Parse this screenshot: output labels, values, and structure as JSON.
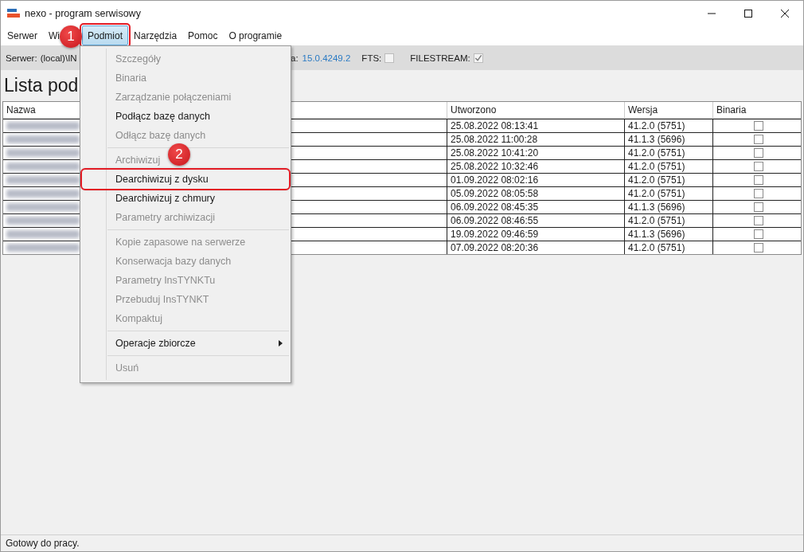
{
  "window": {
    "title": "nexo - program serwisowy"
  },
  "menu_bar": [
    {
      "label": "Serwer",
      "selected": false,
      "annotated": false
    },
    {
      "label": "Wi",
      "selected": false,
      "annotated": false
    },
    {
      "label": "Podmiot",
      "selected": true,
      "annotated": true
    },
    {
      "label": "Narzędzia",
      "selected": false,
      "annotated": false
    },
    {
      "label": "Pomoc",
      "selected": false,
      "annotated": false
    },
    {
      "label": "O programie",
      "selected": false,
      "annotated": false
    }
  ],
  "server_bar": {
    "server_label": "Serwer:",
    "server_value": "(local)\\IN",
    "version_label": "a:",
    "version_value": "15.0.4249.2",
    "fts_label": "FTS:",
    "fts_checked": false,
    "filestream_label": "FILESTREAM:",
    "filestream_checked": true
  },
  "heading": "Lista pod",
  "table": {
    "columns": [
      "Nazwa",
      "Utworzono",
      "Wersja",
      "Binaria"
    ],
    "rows": [
      {
        "created": "25.08.2022 08:13:41",
        "version": "41.2.0 (5751)",
        "binaria": false
      },
      {
        "created": "25.08.2022 11:00:28",
        "version": "41.1.3 (5696)",
        "binaria": false
      },
      {
        "created": "25.08.2022 10:41:20",
        "version": "41.2.0 (5751)",
        "binaria": false
      },
      {
        "created": "25.08.2022 10:32:46",
        "version": "41.2.0 (5751)",
        "binaria": false
      },
      {
        "created": "01.09.2022 08:02:16",
        "version": "41.2.0 (5751)",
        "binaria": false
      },
      {
        "created": "05.09.2022 08:05:58",
        "version": "41.2.0 (5751)",
        "binaria": false
      },
      {
        "created": "06.09.2022 08:45:35",
        "version": "41.1.3 (5696)",
        "binaria": false
      },
      {
        "created": "06.09.2022 08:46:55",
        "version": "41.2.0 (5751)",
        "binaria": false
      },
      {
        "created": "19.09.2022 09:46:59",
        "version": "41.1.3 (5696)",
        "binaria": false
      },
      {
        "created": "07.09.2022 08:20:36",
        "version": "41.2.0 (5751)",
        "binaria": false
      }
    ]
  },
  "menu": {
    "items": [
      {
        "kind": "item",
        "label": "Szczegóły",
        "disabled": true,
        "annotated": false,
        "submenu": false
      },
      {
        "kind": "item",
        "label": "Binaria",
        "disabled": true,
        "annotated": false,
        "submenu": false
      },
      {
        "kind": "item",
        "label": "Zarządzanie połączeniami",
        "disabled": true,
        "annotated": false,
        "submenu": false
      },
      {
        "kind": "item",
        "label": "Podłącz bazę danych",
        "disabled": false,
        "annotated": false,
        "submenu": false
      },
      {
        "kind": "item",
        "label": "Odłącz bazę danych",
        "disabled": true,
        "annotated": false,
        "submenu": false
      },
      {
        "kind": "separator"
      },
      {
        "kind": "item",
        "label": "Archiwizuj",
        "disabled": true,
        "annotated": false,
        "submenu": false
      },
      {
        "kind": "item",
        "label": "Dearchiwizuj z dysku",
        "disabled": false,
        "annotated": true,
        "submenu": false
      },
      {
        "kind": "item",
        "label": "Dearchiwizuj z chmury",
        "disabled": false,
        "annotated": false,
        "submenu": false
      },
      {
        "kind": "item",
        "label": "Parametry archiwizacji",
        "disabled": true,
        "annotated": false,
        "submenu": false
      },
      {
        "kind": "separator"
      },
      {
        "kind": "item",
        "label": "Kopie zapasowe na serwerze",
        "disabled": true,
        "annotated": false,
        "submenu": false
      },
      {
        "kind": "item",
        "label": "Konserwacja bazy danych",
        "disabled": true,
        "annotated": false,
        "submenu": false
      },
      {
        "kind": "item",
        "label": "Parametry InsTYNKTu",
        "disabled": true,
        "annotated": false,
        "submenu": false
      },
      {
        "kind": "item",
        "label": "Przebuduj InsTYNKT",
        "disabled": true,
        "annotated": false,
        "submenu": false
      },
      {
        "kind": "item",
        "label": "Kompaktuj",
        "disabled": true,
        "annotated": false,
        "submenu": false
      },
      {
        "kind": "separator"
      },
      {
        "kind": "item",
        "label": "Operacje zbiorcze",
        "disabled": false,
        "annotated": false,
        "submenu": true
      },
      {
        "kind": "separator"
      },
      {
        "kind": "item",
        "label": "Usuń",
        "disabled": true,
        "annotated": false,
        "submenu": false
      }
    ]
  },
  "badges": [
    "1",
    "2"
  ],
  "status_bar": "Gotowy do pracy."
}
